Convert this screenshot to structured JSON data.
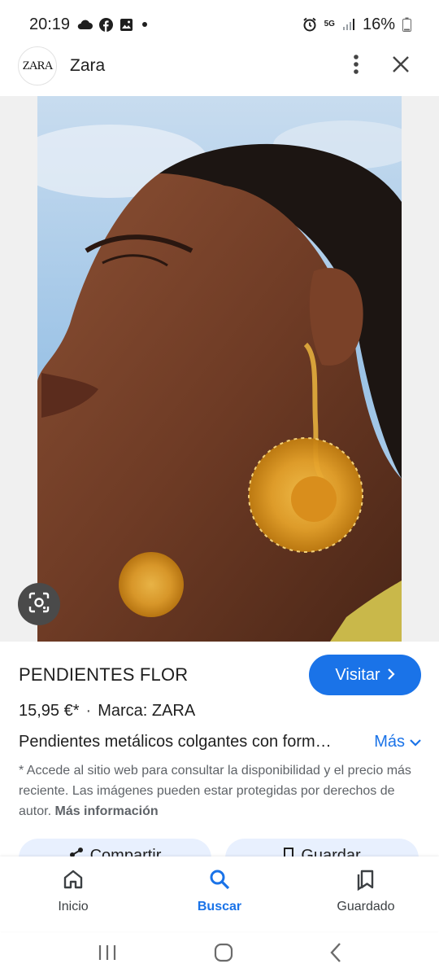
{
  "status_bar": {
    "time": "20:19",
    "network": "5G",
    "battery": "16%",
    "left_icons": [
      "cloud-icon",
      "facebook-icon",
      "gallery-icon",
      "dot-icon"
    ],
    "right_icons": [
      "alarm-icon",
      "signal-icon",
      "battery-icon"
    ]
  },
  "header": {
    "logo_text": "ZARA",
    "site_name": "Zara",
    "icons": [
      "more-vert-icon",
      "close-icon"
    ]
  },
  "product": {
    "title": "PENDIENTES FLOR",
    "visit_label": "Visitar",
    "price": "15,95 €*",
    "separator": "·",
    "brand": "Marca: ZARA",
    "description": "Pendientes metálicos colgantes con form…",
    "more_label": "Más",
    "disclaimer": "* Accede al sitio web para consultar la disponibilidad y el precio más reciente. Las imágenes pueden estar protegidas por derechos de autor.",
    "more_info_label": "Más información"
  },
  "actions": {
    "share_label": "Compartir",
    "save_label": "Guardar"
  },
  "bottom_nav": {
    "items": [
      {
        "label": "Inicio",
        "icon": "home-icon",
        "active": false
      },
      {
        "label": "Buscar",
        "icon": "search-icon",
        "active": true
      },
      {
        "label": "Guardado",
        "icon": "bookmarks-icon",
        "active": false
      }
    ]
  },
  "colors": {
    "accent": "#1a73e8",
    "text": "#1f1f1f",
    "secondary_text": "#5f6368",
    "chip_bg": "#e8f0fe"
  }
}
